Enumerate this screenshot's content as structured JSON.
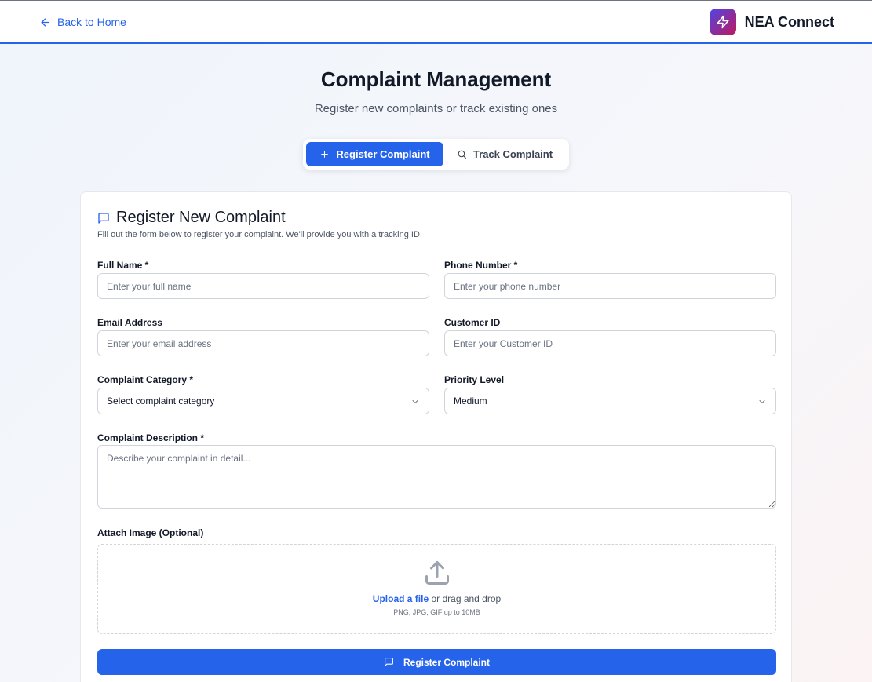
{
  "header": {
    "back_label": "Back to Home",
    "brand_name": "NEA Connect",
    "brand_icon": "lightning-bolt-icon"
  },
  "page": {
    "title": "Complaint Management",
    "subtitle": "Register new complaints or track existing ones"
  },
  "tabs": [
    {
      "label": "Register Complaint",
      "icon": "plus-icon",
      "active": true
    },
    {
      "label": "Track Complaint",
      "icon": "search-icon",
      "active": false
    }
  ],
  "form": {
    "title": "Register New Complaint",
    "description": "Fill out the form below to register your complaint. We'll provide you with a tracking ID.",
    "full_name": {
      "label": "Full Name *",
      "placeholder": "Enter your full name",
      "value": ""
    },
    "phone": {
      "label": "Phone Number *",
      "placeholder": "Enter your phone number",
      "value": ""
    },
    "email": {
      "label": "Email Address",
      "placeholder": "Enter your email address",
      "value": ""
    },
    "customer_id": {
      "label": "Customer ID",
      "placeholder": "Enter your Customer ID",
      "value": ""
    },
    "category": {
      "label": "Complaint Category *",
      "selected": "Select complaint category"
    },
    "priority": {
      "label": "Priority Level",
      "selected": "Medium"
    },
    "description_field": {
      "label": "Complaint Description *",
      "placeholder": "Describe your complaint in detail...",
      "value": ""
    },
    "attachment": {
      "label": "Attach Image (Optional)",
      "link_text": "Upload a file",
      "drag_text": " or drag and drop",
      "hint": "PNG, JPG, GIF up to 10MB"
    },
    "submit_label": "Register Complaint"
  },
  "colors": {
    "accent": "#2563eb",
    "brand_gradient_start": "#4f46e5",
    "brand_gradient_end": "#be185d"
  }
}
